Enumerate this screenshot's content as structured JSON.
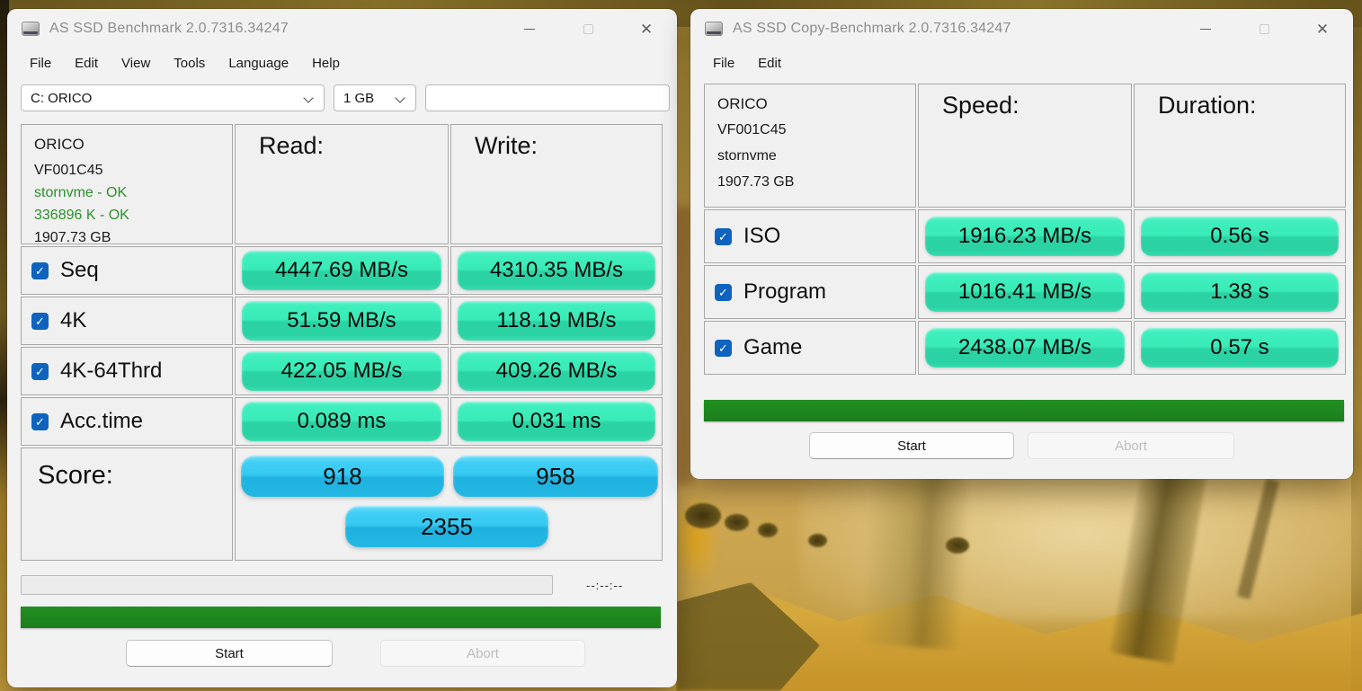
{
  "left": {
    "title": "AS SSD Benchmark 2.0.7316.34247",
    "menu": [
      "File",
      "Edit",
      "View",
      "Tools",
      "Language",
      "Help"
    ],
    "drive_combo": "C: ORICO",
    "size_combo": "1 GB",
    "info": {
      "model": "ORICO",
      "firmware": "VF001C45",
      "driver_status": "stornvme - OK",
      "offset_status": "336896 K - OK",
      "capacity": "1907.73 GB"
    },
    "col_read": "Read:",
    "col_write": "Write:",
    "rows": [
      {
        "label": "Seq",
        "read": "4447.69 MB/s",
        "write": "4310.35 MB/s",
        "checked": true
      },
      {
        "label": "4K",
        "read": "51.59 MB/s",
        "write": "118.19 MB/s",
        "checked": true
      },
      {
        "label": "4K-64Thrd",
        "read": "422.05 MB/s",
        "write": "409.26 MB/s",
        "checked": true
      },
      {
        "label": "Acc.time",
        "read": "0.089 ms",
        "write": "0.031 ms",
        "checked": true
      }
    ],
    "score_label": "Score:",
    "score_read": "918",
    "score_write": "958",
    "score_total": "2355",
    "eta": "--:--:--",
    "start": "Start",
    "abort": "Abort"
  },
  "right": {
    "title": "AS SSD Copy-Benchmark 2.0.7316.34247",
    "menu": [
      "File",
      "Edit"
    ],
    "info": {
      "model": "ORICO",
      "firmware": "VF001C45",
      "driver": "stornvme",
      "capacity": "1907.73 GB"
    },
    "col_speed": "Speed:",
    "col_duration": "Duration:",
    "rows": [
      {
        "label": "ISO",
        "speed": "1916.23 MB/s",
        "duration": "0.56 s",
        "checked": true
      },
      {
        "label": "Program",
        "speed": "1016.41 MB/s",
        "duration": "1.38 s",
        "checked": true
      },
      {
        "label": "Game",
        "speed": "2438.07 MB/s",
        "duration": "0.57 s",
        "checked": true
      }
    ],
    "start": "Start",
    "abort": "Abort"
  },
  "icons": {
    "check": "✓",
    "close": "✕"
  },
  "colors": {
    "result_pill_green": "#35e9b6",
    "score_pill_blue": "#2fc5ee",
    "progress_green": "#1f8b1f",
    "checkbox_blue": "#0e63be",
    "ok_text_green": "#2f8f2f",
    "window_bg": "#f2f2f2"
  }
}
